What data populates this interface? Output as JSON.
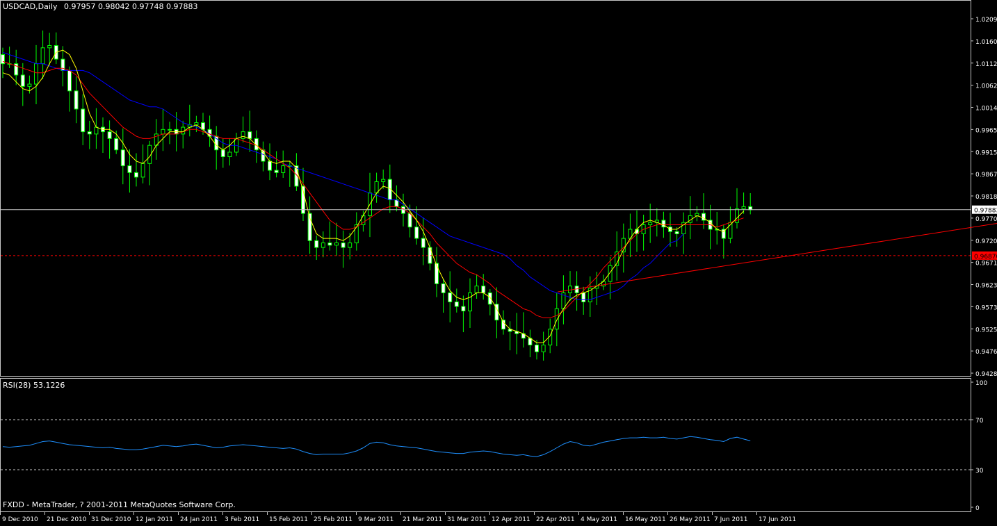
{
  "header": {
    "symbol": "USDCAD,Daily",
    "ohlc": "0.97957 0.98042 0.97748 0.97883"
  },
  "footer": {
    "copyright": "FXDD - MetaTrader, ? 2001-2011 MetaQuotes Software Corp."
  },
  "colors": {
    "background": "#000000",
    "frame": "#c8c8c8",
    "candle": "#00ff00",
    "candle_fill_up": "#000000",
    "candle_fill_down": "#ffffff",
    "ma_fast": "#ffff00",
    "ma_mid": "#ff0000",
    "ma_slow": "#0000ff",
    "trendline": "#ff0000",
    "rsi_line": "#1e90ff",
    "price_line": "#c0c0c0",
    "level_line": "#ff0000",
    "bid_label_bg": "#ffffff",
    "level_label_bg": "#ff0000"
  },
  "chart_data": [
    {
      "type": "candlestick",
      "name": "USDCAD,Daily",
      "ylim": [
        0.9428,
        1.0209
      ],
      "y_ticks": [
        "1.02095",
        "1.01600",
        "1.01120",
        "1.00625",
        "1.00145",
        "0.99650",
        "0.99155",
        "0.98675",
        "0.98180",
        "0.97700",
        "0.97205",
        "0.96710",
        "0.96230",
        "0.95735",
        "0.95255",
        "0.94760",
        "0.94280"
      ],
      "x_ticks": [
        "9 Dec 2010",
        "21 Dec 2010",
        "31 Dec 2010",
        "12 Jan 2011",
        "24 Jan 2011",
        "3 Feb 2011",
        "15 Feb 2011",
        "25 Feb 2011",
        "9 Mar 2011",
        "21 Mar 2011",
        "31 Mar 2011",
        "12 Apr 2011",
        "22 Apr 2011",
        "4 May 2011",
        "16 May 2011",
        "26 May 2011",
        "7 Jun 2011",
        "17 Jun 2011"
      ],
      "current_price": {
        "value": 0.97883,
        "label": "0.97883"
      },
      "horizontal_level": {
        "value": 0.9687,
        "label": "0.96870"
      },
      "trendline": {
        "start": {
          "date": "27 Apr 2011",
          "price": 0.9607
        },
        "end": {
          "date": "5 Jul 2011",
          "price": 0.9758
        }
      },
      "ma_fast_values": [
        1.009,
        1.0085,
        1.007,
        1.0055,
        1.005,
        1.006,
        1.008,
        1.011,
        1.0135,
        1.014,
        1.013,
        1.01,
        1.005,
        1.0,
        0.997,
        0.9965,
        0.9965,
        0.9955,
        0.9935,
        0.991,
        0.9895,
        0.989,
        0.9905,
        0.993,
        0.9945,
        0.996,
        0.996,
        0.996,
        0.997,
        0.9975,
        0.9965,
        0.995,
        0.993,
        0.992,
        0.993,
        0.9945,
        0.995,
        0.9945,
        0.993,
        0.9915,
        0.9895,
        0.989,
        0.9895,
        0.9895,
        0.988,
        0.983,
        0.977,
        0.9735,
        0.9725,
        0.9725,
        0.9725,
        0.972,
        0.973,
        0.975,
        0.9775,
        0.98,
        0.9825,
        0.984,
        0.9835,
        0.982,
        0.9805,
        0.9785,
        0.9765,
        0.974,
        0.9705,
        0.9665,
        0.9635,
        0.961,
        0.9595,
        0.959,
        0.9595,
        0.9605,
        0.9605,
        0.9595,
        0.957,
        0.954,
        0.9525,
        0.952,
        0.9515,
        0.9505,
        0.9495,
        0.9495,
        0.951,
        0.9545,
        0.957,
        0.959,
        0.96,
        0.9605,
        0.961,
        0.962,
        0.963,
        0.965,
        0.967,
        0.97,
        0.9725,
        0.9745,
        0.976,
        0.9765,
        0.976,
        0.9755,
        0.9745,
        0.9745,
        0.9755,
        0.9765,
        0.9775,
        0.977,
        0.976,
        0.9745,
        0.974,
        0.9755,
        0.977,
        0.9785
      ],
      "ma_mid_values": [
        1.0115,
        1.011,
        1.0105,
        1.01,
        1.0095,
        1.009,
        1.009,
        1.0095,
        1.01,
        1.01,
        1.0095,
        1.0085,
        1.0065,
        1.0045,
        1.003,
        1.0015,
        1.0,
        0.9985,
        0.997,
        0.996,
        0.995,
        0.9945,
        0.9945,
        0.995,
        0.9955,
        0.9955,
        0.9955,
        0.996,
        0.9965,
        0.9965,
        0.996,
        0.9955,
        0.995,
        0.9945,
        0.9945,
        0.9945,
        0.994,
        0.9935,
        0.993,
        0.992,
        0.991,
        0.99,
        0.989,
        0.988,
        0.9865,
        0.9845,
        0.9825,
        0.9805,
        0.9785,
        0.9765,
        0.9755,
        0.9745,
        0.9745,
        0.975,
        0.976,
        0.977,
        0.978,
        0.979,
        0.9795,
        0.9795,
        0.979,
        0.978,
        0.9765,
        0.975,
        0.9735,
        0.9715,
        0.97,
        0.9685,
        0.967,
        0.966,
        0.965,
        0.9645,
        0.9635,
        0.9625,
        0.961,
        0.96,
        0.959,
        0.958,
        0.957,
        0.9565,
        0.9555,
        0.955,
        0.955,
        0.9555,
        0.9565,
        0.958,
        0.9595,
        0.961,
        0.9625,
        0.964,
        0.966,
        0.9675,
        0.969,
        0.9705,
        0.972,
        0.9735,
        0.9745,
        0.975,
        0.9755,
        0.9755,
        0.9755,
        0.9755,
        0.9755,
        0.9755,
        0.9755,
        0.9755,
        0.9755,
        0.975,
        0.9755,
        0.976,
        0.9765,
        0.977
      ],
      "ma_slow_values": [
        1.0135,
        1.013,
        1.0125,
        1.012,
        1.0115,
        1.011,
        1.011,
        1.0105,
        1.01,
        1.0095,
        1.0095,
        1.0095,
        1.0095,
        1.009,
        1.008,
        1.007,
        1.006,
        1.005,
        1.004,
        1.003,
        1.0025,
        1.002,
        1.0015,
        1.0015,
        1.001,
        1.0,
        0.999,
        0.998,
        0.9975,
        0.997,
        0.9965,
        0.9955,
        0.9945,
        0.9935,
        0.993,
        0.993,
        0.9925,
        0.992,
        0.9915,
        0.991,
        0.9905,
        0.99,
        0.989,
        0.9885,
        0.988,
        0.9875,
        0.987,
        0.9865,
        0.986,
        0.9855,
        0.985,
        0.9845,
        0.984,
        0.9835,
        0.983,
        0.9825,
        0.982,
        0.9815,
        0.981,
        0.981,
        0.98,
        0.979,
        0.978,
        0.977,
        0.976,
        0.975,
        0.974,
        0.973,
        0.9725,
        0.972,
        0.9715,
        0.971,
        0.9705,
        0.97,
        0.9695,
        0.969,
        0.968,
        0.9665,
        0.9655,
        0.964,
        0.963,
        0.962,
        0.961,
        0.9605,
        0.96,
        0.9595,
        0.959,
        0.959,
        0.959,
        0.9595,
        0.96,
        0.9605,
        0.961,
        0.962,
        0.9635,
        0.9645,
        0.966,
        0.967,
        0.9685,
        0.97,
        0.9715,
        0.972,
        0.9735
      ],
      "trend_values": [
        1.011,
        1.011,
        1.0085,
        1.006,
        1.0065,
        1.011,
        1.0145,
        1.015,
        1.012,
        1.0095,
        1.005,
        1.001,
        0.996,
        0.9955,
        0.997,
        0.996,
        0.9945,
        0.992,
        0.9885,
        0.987,
        0.986,
        0.989,
        0.993,
        0.9955,
        0.9965,
        0.9965,
        0.9955,
        0.997,
        0.9975,
        0.998,
        0.9965,
        0.995,
        0.992,
        0.9905,
        0.9915,
        0.9945,
        0.996,
        0.9945,
        0.992,
        0.9895,
        0.9875,
        0.987,
        0.9885,
        0.9885,
        0.984,
        0.978,
        0.972,
        0.9705,
        0.9715,
        0.971,
        0.9715,
        0.9705,
        0.9715,
        0.9755,
        0.9775,
        0.9825,
        0.985,
        0.9855,
        0.981,
        0.9795,
        0.978,
        0.975,
        0.9725,
        0.9705,
        0.967,
        0.9625,
        0.9605,
        0.9585,
        0.9575,
        0.9565,
        0.9605,
        0.962,
        0.9605,
        0.958,
        0.9545,
        0.9525,
        0.952,
        0.9515,
        0.9505,
        0.949,
        0.9475,
        0.949,
        0.9525,
        0.957,
        0.9605,
        0.962,
        0.9605,
        0.9585,
        0.9615,
        0.962,
        0.963,
        0.9665,
        0.9695,
        0.9725,
        0.9745,
        0.9735,
        0.9755,
        0.976,
        0.9765,
        0.975,
        0.974,
        0.9735,
        0.976,
        0.9775,
        0.978,
        0.9765,
        0.9745,
        0.9745,
        0.9725,
        0.976,
        0.979,
        0.9795,
        0.9788
      ]
    },
    {
      "type": "line",
      "name": "RSI(28) 53.1226",
      "ylim": [
        0,
        100
      ],
      "y_ticks": [
        "100",
        "70",
        "30",
        "0"
      ],
      "levels": [
        70,
        30
      ],
      "values": [
        48.5,
        48,
        48.5,
        49,
        49.5,
        51,
        52.5,
        53,
        52,
        51,
        50,
        49.5,
        49,
        48.5,
        48,
        47.5,
        48,
        47,
        46.5,
        46,
        46,
        46.5,
        47.5,
        48.5,
        49.5,
        49,
        48.5,
        49,
        50,
        50.5,
        49.5,
        48.5,
        47.5,
        48,
        49,
        49.5,
        50,
        49.5,
        49,
        48.5,
        48,
        47.5,
        47,
        47.5,
        46.5,
        44.5,
        43,
        42,
        42.5,
        42.5,
        42.5,
        42.5,
        43.5,
        45,
        47.5,
        51,
        52,
        51.5,
        50,
        49,
        48.5,
        48,
        47.5,
        46.5,
        45.5,
        44.5,
        44,
        43.5,
        43,
        43,
        44,
        44.5,
        45,
        44.5,
        43.5,
        42.5,
        42,
        41.5,
        42,
        41,
        40.5,
        42,
        44.5,
        47.5,
        50.5,
        52.5,
        51.5,
        49.5,
        49,
        50.5,
        52,
        53,
        54,
        55,
        55.5,
        55.5,
        56,
        55.5,
        55.5,
        56,
        55,
        54.5,
        55.5,
        56.5,
        56,
        55,
        54,
        53.5,
        52.5,
        55,
        56,
        54.5,
        53.1
      ]
    }
  ]
}
